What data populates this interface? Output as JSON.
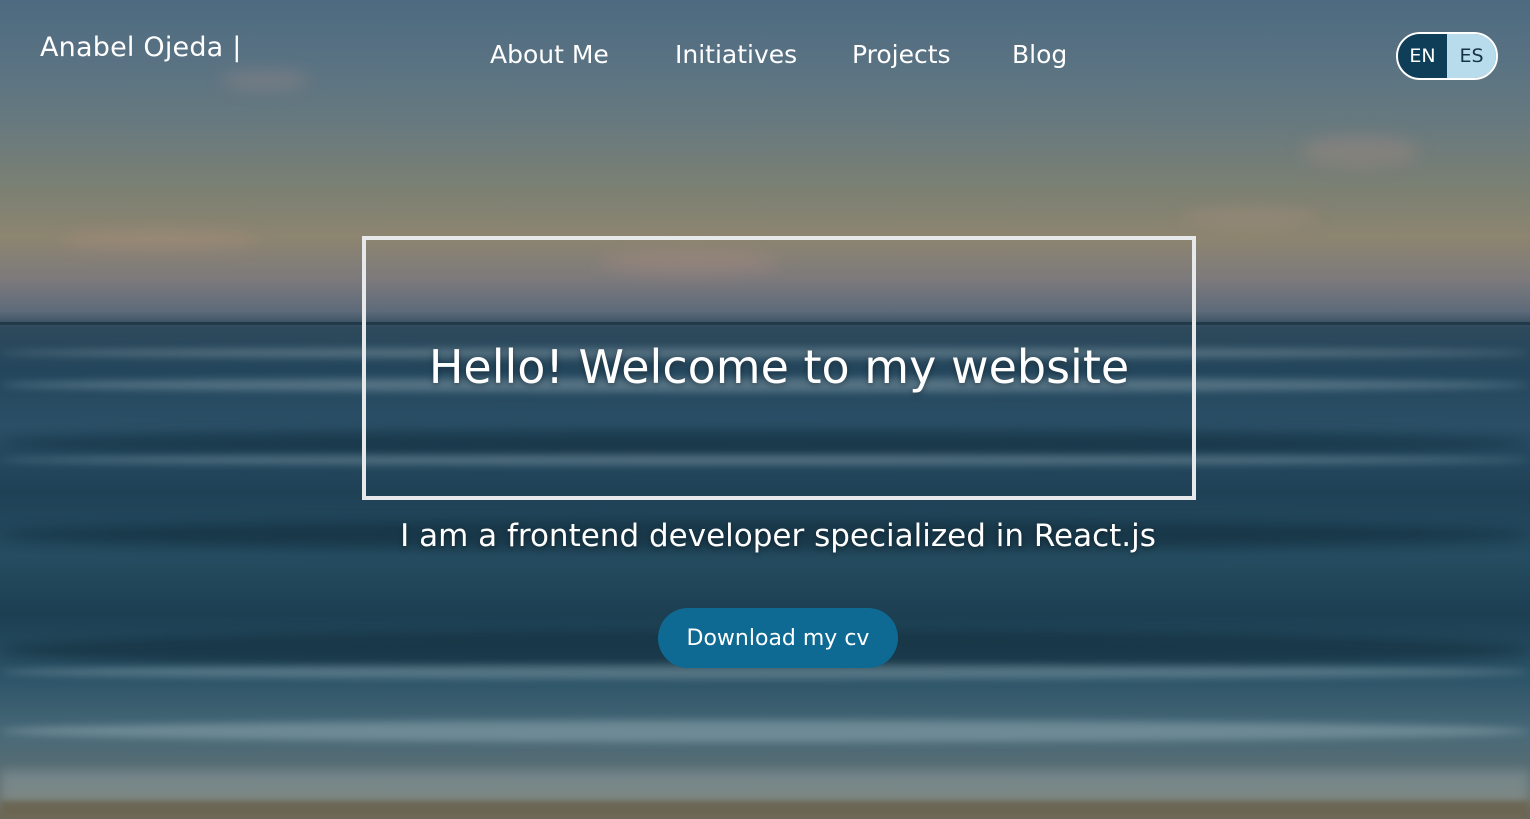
{
  "header": {
    "brand": "Anabel Ojeda |",
    "nav": {
      "about": "About Me",
      "initiatives": "Initiatives",
      "projects": "Projects",
      "blog": "Blog"
    },
    "language": {
      "options": [
        "EN",
        "ES"
      ],
      "selected": "EN"
    }
  },
  "hero": {
    "headline": "Hello! Welcome to my website",
    "subtitle": "I am a frontend developer specialized in React.js",
    "cta_label": "Download my cv"
  },
  "colors": {
    "cta_background": "#0f6a93",
    "lang_active": "#0f3e58",
    "lang_inactive": "#b9dcec",
    "frame_border": "#e6e8ea"
  }
}
